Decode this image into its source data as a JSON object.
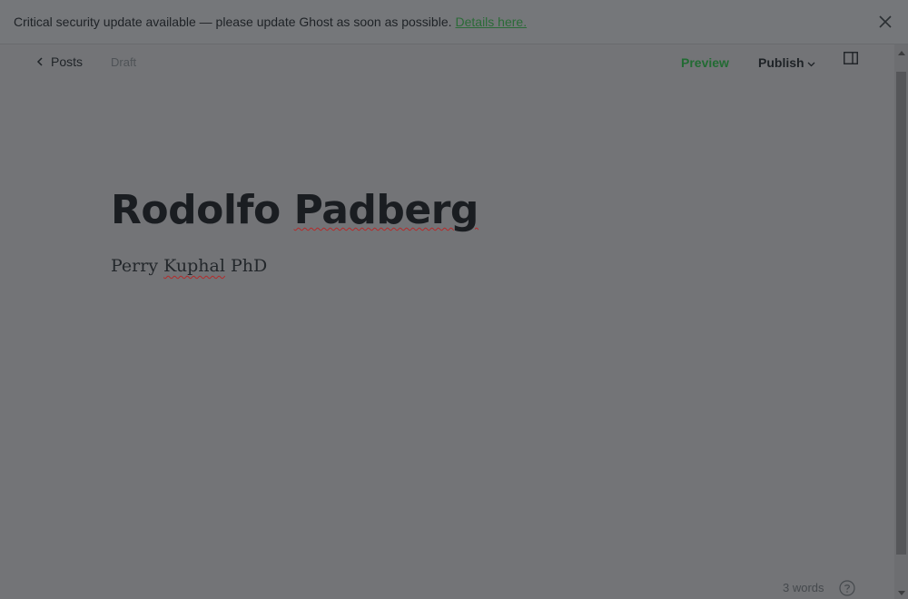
{
  "banner": {
    "message": "Critical security update available — please update Ghost as soon as possible.",
    "link_text": "Details here.",
    "close_icon": "close-icon"
  },
  "topbar": {
    "back_label": "Posts",
    "status": "Draft",
    "preview_label": "Preview",
    "publish_label": "Publish",
    "sidebar_toggle_icon": "sidebar-toggle-icon"
  },
  "post": {
    "title_part1": "Rodolfo",
    "title_part2": "Padberg",
    "body_part1": "Perry",
    "body_part2": "Kuphal",
    "body_part3": "PhD"
  },
  "footer": {
    "word_count": "3 words",
    "help_icon": "help-icon"
  },
  "colors": {
    "overlay_bg": "#737477",
    "accent_green": "#226b33",
    "spellcheck_red": "#b52a2a"
  }
}
